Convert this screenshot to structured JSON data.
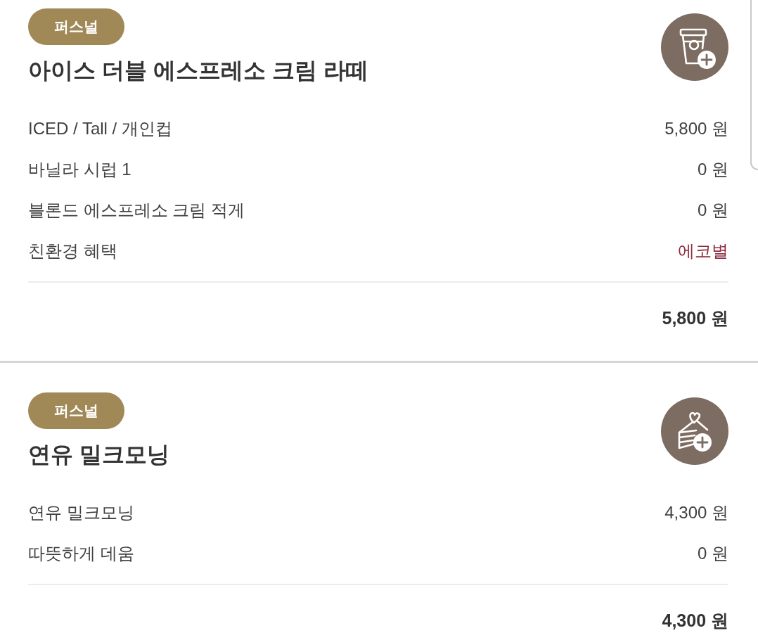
{
  "orders": [
    {
      "badge": "퍼스널",
      "name": "아이스 더블 에스프레소 크림 라떼",
      "kind": "drink",
      "options": [
        {
          "label": "ICED / Tall / 개인컵",
          "price": "5,800 원",
          "highlight": false
        },
        {
          "label": "바닐라 시럽 1",
          "price": "0 원",
          "highlight": false
        },
        {
          "label": "블론드 에스프레소 크림 적게",
          "price": "0 원",
          "highlight": false
        },
        {
          "label": "친환경 혜택",
          "price": "에코별",
          "highlight": true
        }
      ],
      "total": "5,800 원"
    },
    {
      "badge": "퍼스널",
      "name": "연유 밀크모닝",
      "kind": "food",
      "options": [
        {
          "label": "연유 밀크모닝",
          "price": "4,300 원",
          "highlight": false
        },
        {
          "label": "따뜻하게 데움",
          "price": "0 원",
          "highlight": false
        }
      ],
      "total": "4,300 원"
    }
  ]
}
